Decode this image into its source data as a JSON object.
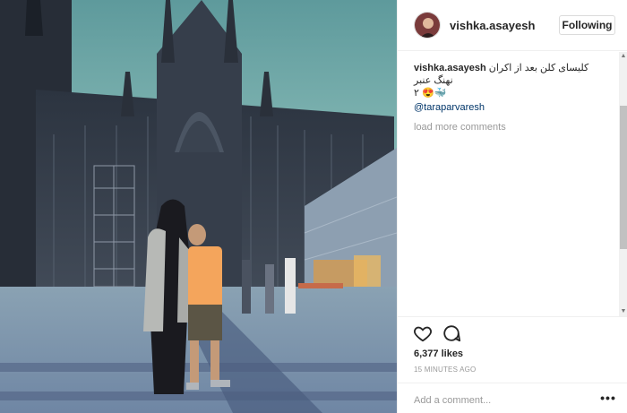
{
  "post": {
    "username": "vishka.asayesh",
    "follow_label": "Following",
    "caption": {
      "username": "vishka.asayesh",
      "text": "کلیسای کلن بعد از اکران نهنگ عنبر",
      "line2": "۲ 😍🐳"
    },
    "mention": "@taraparvaresh",
    "load_more": "load more comments",
    "likes": "6,377 likes",
    "time": "15 MINUTES AGO",
    "add_comment_placeholder": "Add a comment..."
  },
  "icons": {
    "like": "heart-icon",
    "comment": "comment-icon",
    "more": "more-options-icon"
  },
  "colors": {
    "link": "#003569",
    "muted": "#999999",
    "text": "#262626"
  }
}
